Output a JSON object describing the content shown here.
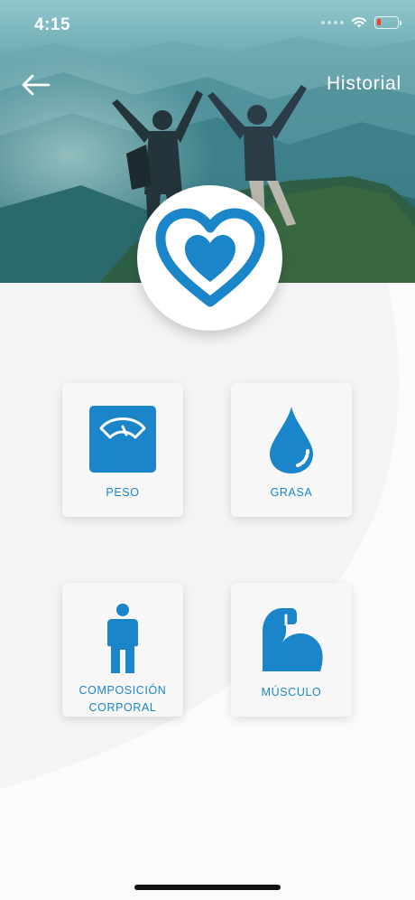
{
  "status_bar": {
    "time": "4:15",
    "battery_level_percent": 10
  },
  "header": {
    "back_icon": "arrow-left-icon",
    "history_label": "Historial"
  },
  "logo": {
    "icon": "heart-in-heart-icon"
  },
  "colors": {
    "accent": "#1a85c8",
    "card_bg": "#f7f7f8",
    "page_bg": "#f4f4f6"
  },
  "cards": [
    {
      "label": "PESO",
      "icon": "scale-icon"
    },
    {
      "label": "GRASA",
      "icon": "drop-icon"
    },
    {
      "label_line1": "COMPOSICIÓN",
      "label_line2": "CORPORAL",
      "icon": "person-icon"
    },
    {
      "label": "MÚSCULO",
      "icon": "flexed-arm-icon"
    }
  ]
}
